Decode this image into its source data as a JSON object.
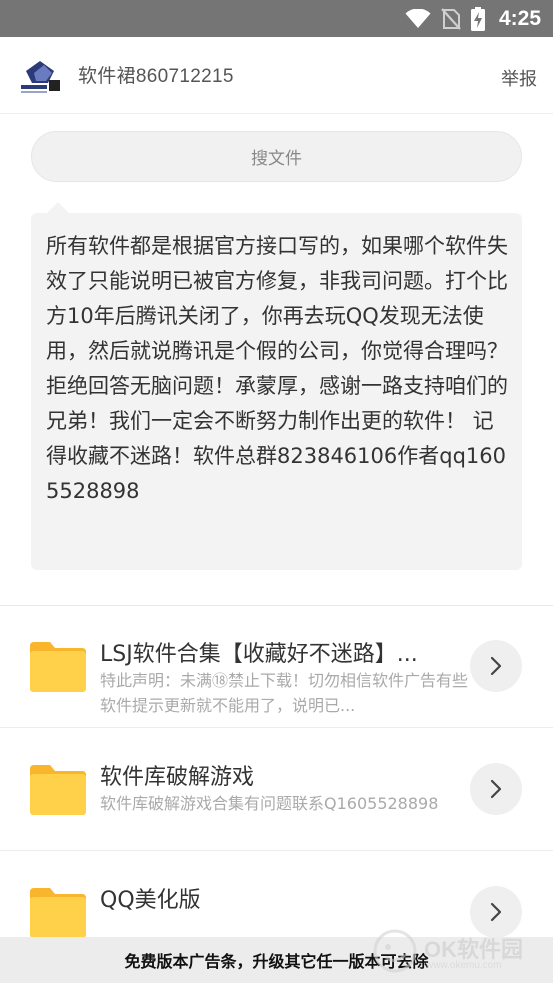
{
  "status_bar": {
    "time": "4:25",
    "icons": [
      "wifi-icon",
      "no-sim-icon",
      "battery-charging-icon"
    ]
  },
  "header": {
    "title": "软件裙860712215",
    "report_label": "举报",
    "logo_icon": "software-library-logo"
  },
  "search": {
    "placeholder": "搜文件"
  },
  "notice": {
    "text": "所有软件都是根据官方接口写的，如果哪个软件失效了只能说明已被官方修复，非我司问题。打个比方10年后腾讯关闭了，你再去玩QQ发现无法使用，然后就说腾讯是个假的公司，你觉得合理吗？拒绝回答无脑问题！承蒙厚，感谢一路支持咱们的兄弟！我们一定会不断努力制作出更的软件！ 记得收藏不迷路！软件总群823846106作者qq1605528898"
  },
  "list": {
    "items": [
      {
        "title": "LSJ软件合集【收藏好不迷路】...",
        "desc": "特此声明：未满⑱禁止下载！切勿相信软件广告有些软件提示更新就不能用了，说明已...",
        "icon": "folder-icon"
      },
      {
        "title": "软件库破解游戏",
        "desc": "软件库破解游戏合集有问题联系Q1605528898",
        "icon": "folder-icon"
      },
      {
        "title": "QQ美化版",
        "desc": "",
        "icon": "folder-icon"
      }
    ]
  },
  "ad_banner": {
    "text": "免费版本广告条，升级其它任一版本可去除"
  },
  "watermark": {
    "brand": "OK软件园",
    "url": "www.okemu.com"
  },
  "colors": {
    "status_bar": "#757575",
    "folder": "#FFC93F",
    "bubble_bg": "#f3f3f3"
  }
}
